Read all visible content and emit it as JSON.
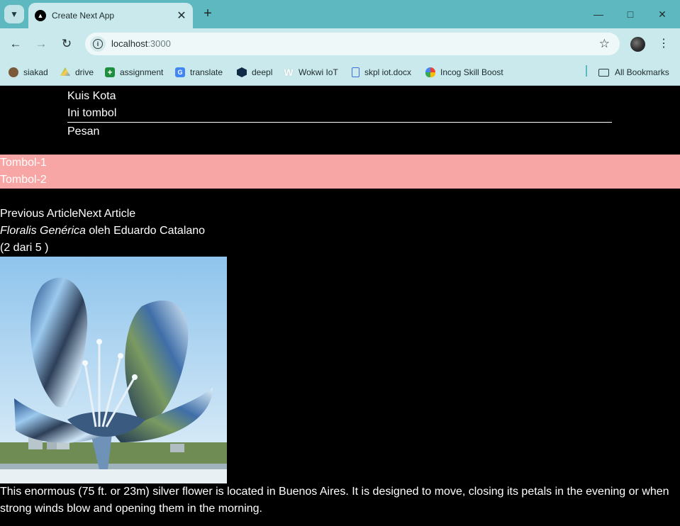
{
  "browser": {
    "tab_title": "Create Next App",
    "url_host": "localhost",
    "url_port": ":3000"
  },
  "bookmarks": [
    {
      "label": "siakad",
      "icon": "siakad-logo-icon",
      "color": "#7b5a3a"
    },
    {
      "label": "drive",
      "icon": "google-drive-icon",
      "color": "#1fa463"
    },
    {
      "label": "assignment",
      "icon": "plus-square-icon",
      "color": "#1e8e3e"
    },
    {
      "label": "translate",
      "icon": "google-translate-icon",
      "color": "#4285f4"
    },
    {
      "label": "deepl",
      "icon": "deepl-icon",
      "color": "#0f2b46"
    },
    {
      "label": "Wokwi IoT",
      "icon": "wokwi-icon",
      "color": "#ffffff"
    },
    {
      "label": "skpl iot.docx",
      "icon": "document-icon",
      "color": "#3c6fd8"
    },
    {
      "label": "Incog Skill Boost",
      "icon": "google-cloud-icon",
      "color": "#ea4335"
    }
  ],
  "all_bookmarks_label": "All Bookmarks",
  "nav": {
    "item_1": "Kuis Kota",
    "item_2": "Ini tombol",
    "item_3": "Pesan"
  },
  "buttons": {
    "btn_1": "Tombol-1",
    "btn_2": "Tombol-2"
  },
  "article": {
    "prev_label": "Previous Article",
    "next_label": "Next Article",
    "title_italic": "Floralis Genérica",
    "author_text": " oleh Eduardo Catalano",
    "count_text": "(2 dari 5 )",
    "image_alt": "Floralis Genérica",
    "description": "This enormous (75 ft. or 23m) silver flower is located in Buenos Aires. It is designed to move, closing its petals in the evening or when strong winds blow and opening them in the morning."
  },
  "colors": {
    "tabbar": "#5db8c0",
    "toolbar": "#c9e9ec",
    "pink_band": "#f8a5a5",
    "page_bg": "#000000"
  }
}
